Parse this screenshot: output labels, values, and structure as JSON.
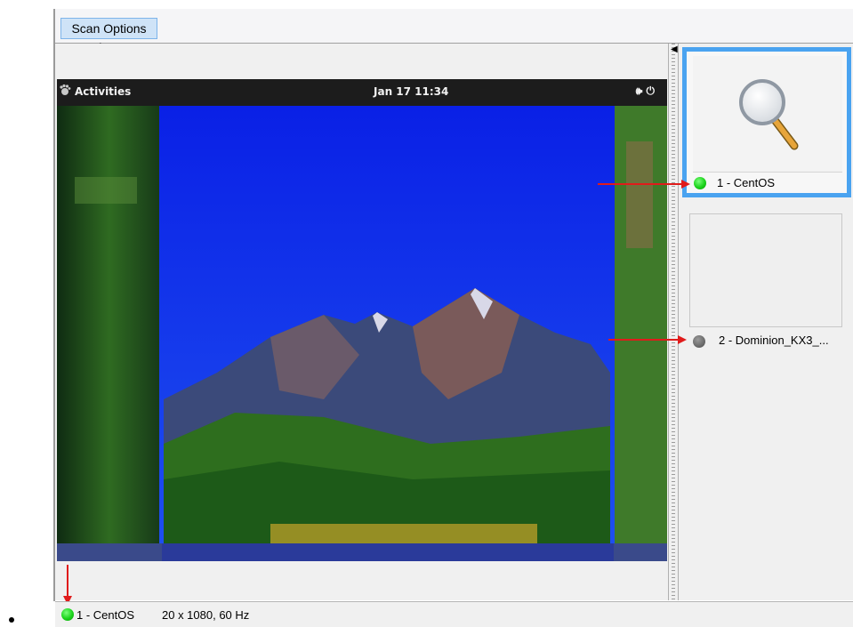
{
  "toolbar": {
    "scan_options_label": "Scan Options"
  },
  "remote_desktop": {
    "activities_label": "Activities",
    "clock": "Jan 17  11:34",
    "tray_text": "🕪 ⏻"
  },
  "targets": [
    {
      "label": "1 - CentOS",
      "status": "online",
      "status_color": "#1bd31b",
      "selected": true
    },
    {
      "label": "2 - Dominion_KX3_...",
      "status": "offline",
      "status_color": "#6b6b6b",
      "selected": false
    }
  ],
  "status_bar": {
    "target_label": "1 - CentOS",
    "resolution": "20 x 1080, 60 Hz"
  },
  "colors": {
    "selection_border": "#4aa3f0",
    "annotation_arrow": "#e01b1b",
    "button_bg": "#cfe3f7"
  },
  "icons": {
    "thumb1": "magnifier-icon",
    "cursor": "mouse-pointer-icon",
    "activities": "gnome-foot-icon"
  }
}
